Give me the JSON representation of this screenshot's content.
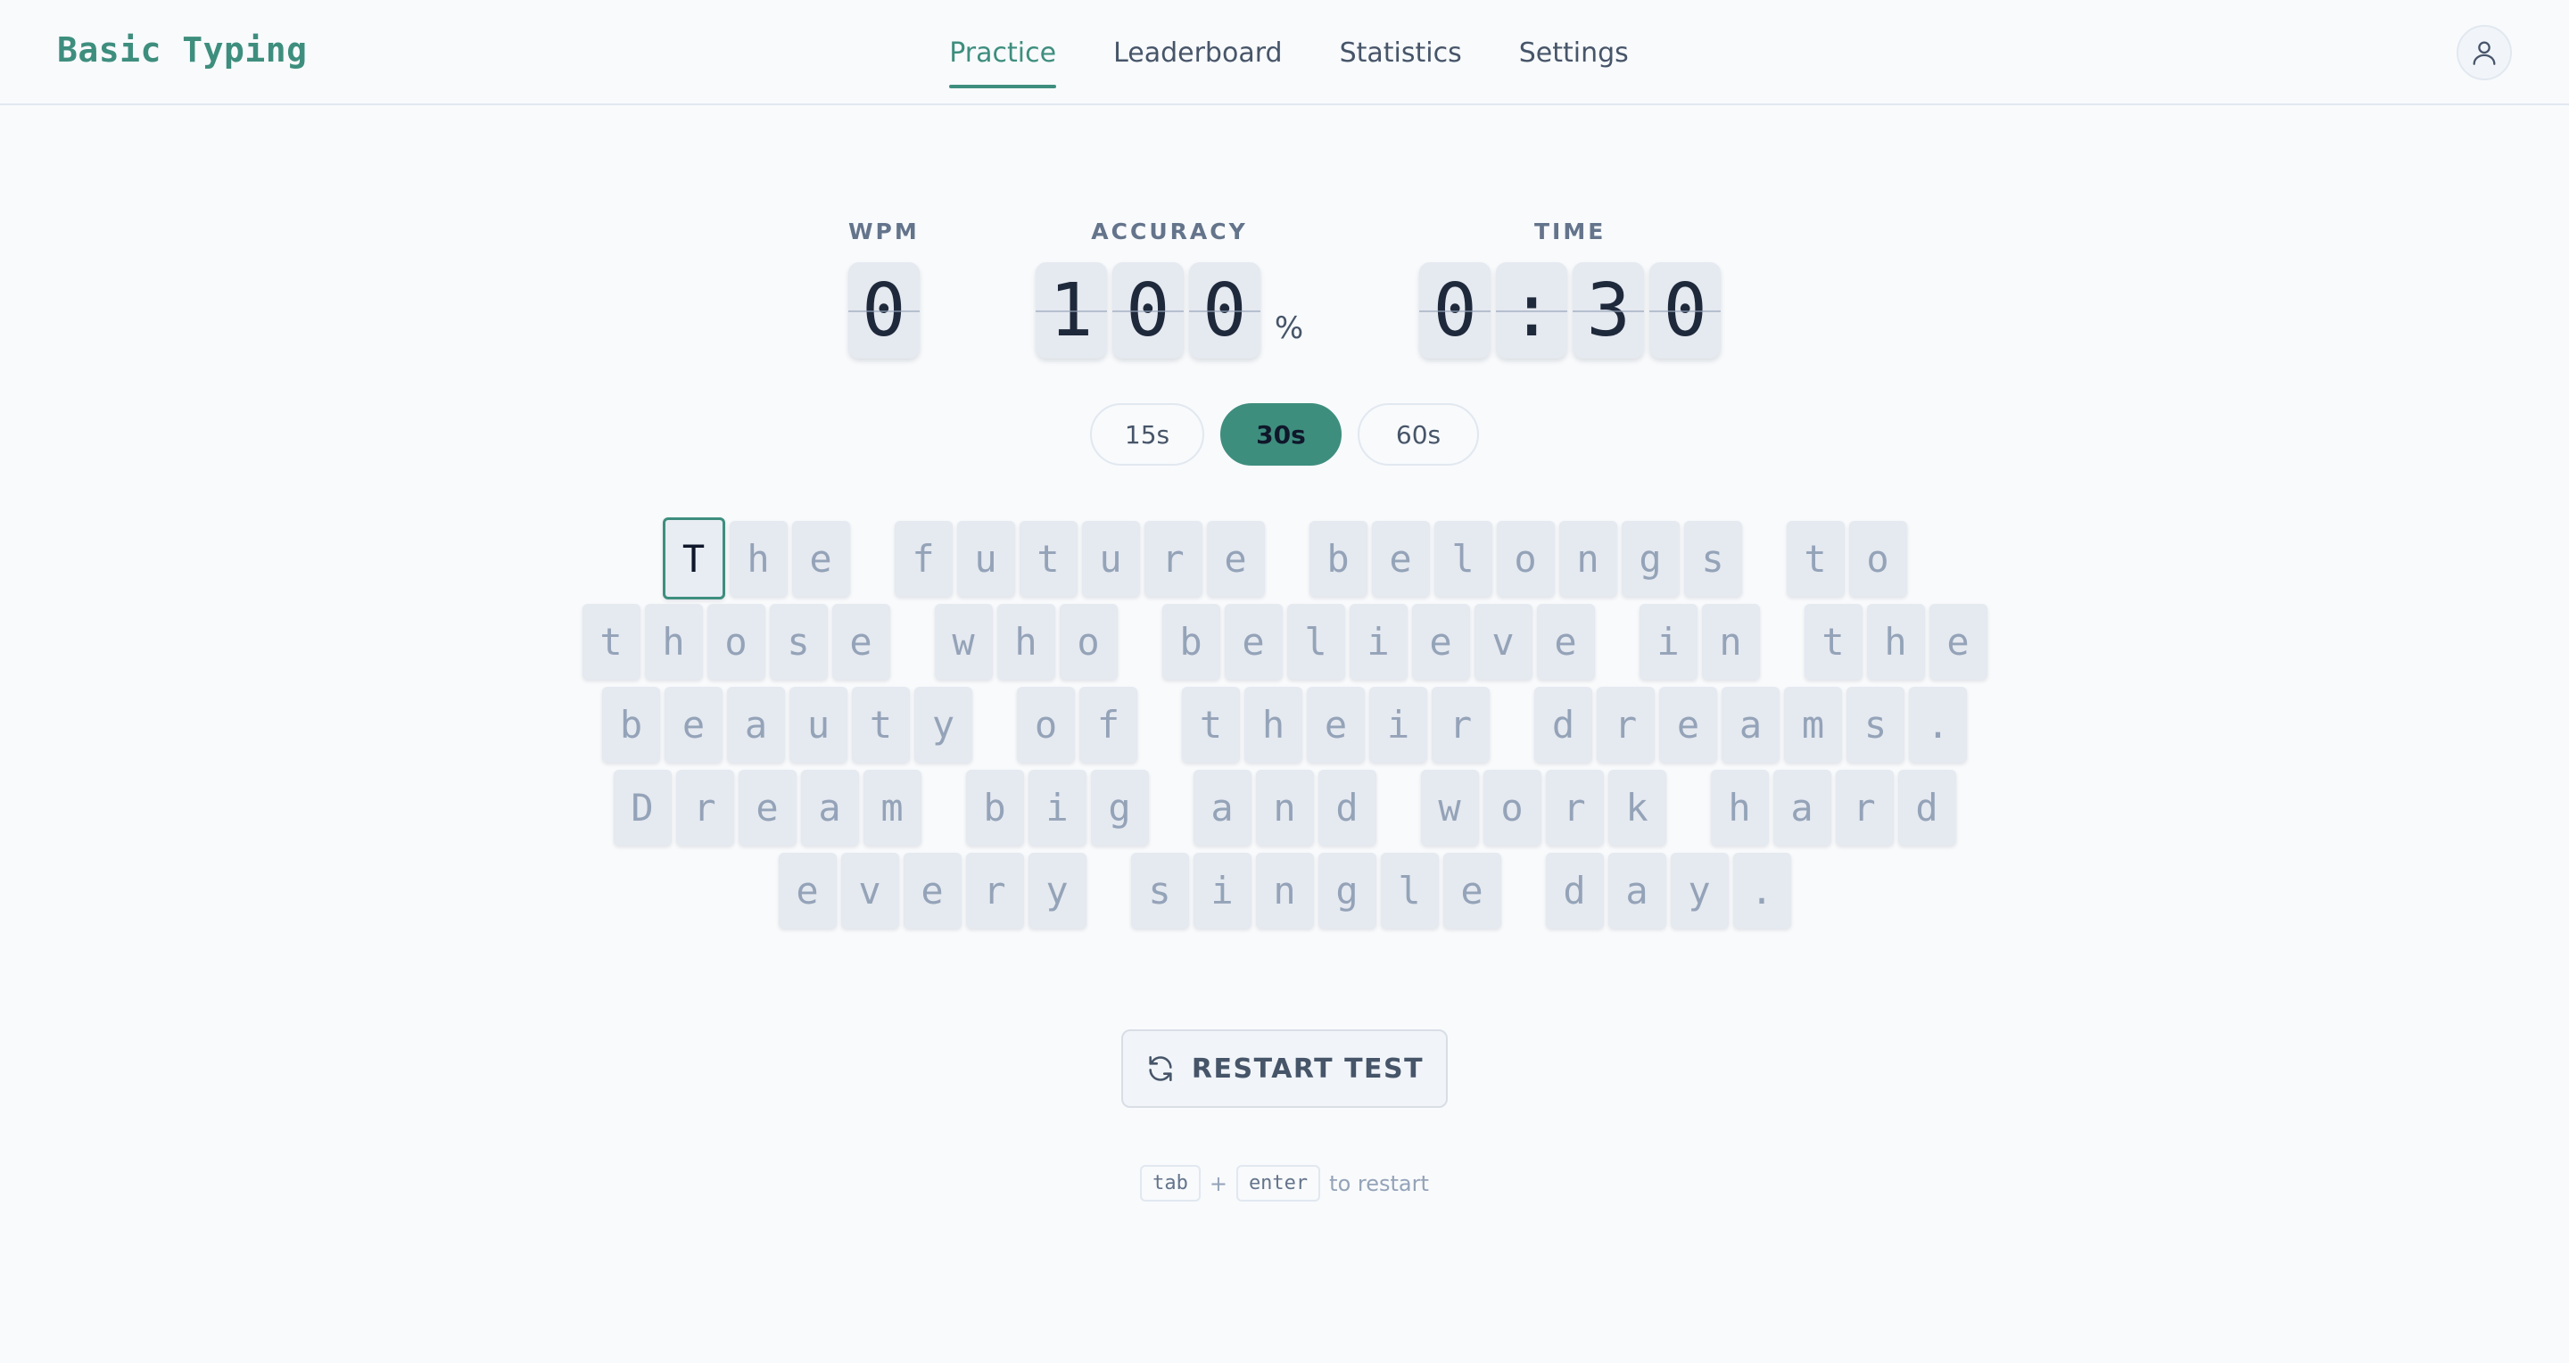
{
  "app": {
    "title": "Basic Typing"
  },
  "nav": {
    "items": [
      {
        "label": "Practice",
        "active": true
      },
      {
        "label": "Leaderboard",
        "active": false
      },
      {
        "label": "Statistics",
        "active": false
      },
      {
        "label": "Settings",
        "active": false
      }
    ],
    "avatar_icon": "user-icon"
  },
  "stats": {
    "wpm": {
      "label": "WPM",
      "value": "0"
    },
    "accuracy": {
      "label": "ACCURACY",
      "value": "100",
      "unit": "%"
    },
    "time": {
      "label": "TIME",
      "value": "0:30"
    }
  },
  "durations": {
    "options": [
      "15s",
      "30s",
      "60s"
    ],
    "selected": "30s"
  },
  "typing": {
    "lines": [
      "The future belongs to",
      "those who believe in the",
      "beauty of their dreams.",
      "Dream big and work hard",
      "every single day."
    ],
    "cursor_index": 0
  },
  "restart": {
    "label": "RESTART TEST",
    "icon": "refresh-icon"
  },
  "hint": {
    "key1": "tab",
    "plus": "+",
    "key2": "enter",
    "text": "to restart"
  },
  "colors": {
    "accent": "#3e8e7e",
    "background": "#f8fafc",
    "tile": "#e5e9f0"
  }
}
